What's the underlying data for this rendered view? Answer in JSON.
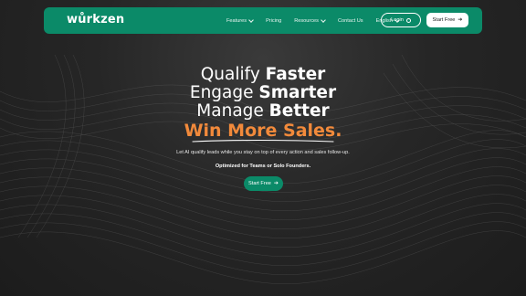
{
  "brand": {
    "logo_text": "wůrkzen",
    "primary_color": "#0b8a68",
    "accent_color": "#f28a3b"
  },
  "nav": {
    "items": [
      {
        "label": "Features",
        "has_dropdown": true
      },
      {
        "label": "Pricing",
        "has_dropdown": false
      },
      {
        "label": "Resources",
        "has_dropdown": true
      },
      {
        "label": "Contact Us",
        "has_dropdown": false
      },
      {
        "label": "English",
        "has_dropdown": true
      }
    ],
    "login_label": "Login",
    "login_icon": "user-circle-icon",
    "start_label": "Start Free",
    "start_icon": "arrow-right-icon"
  },
  "hero": {
    "line1": {
      "light": "Qualify ",
      "bold": "Faster"
    },
    "line2": {
      "light": "Engage ",
      "bold": "Smarter"
    },
    "line3": {
      "light": "Manage ",
      "bold": "Better"
    },
    "accent": "Win More Sales.",
    "subtitle": "Let AI qualify leads while you stay on top of every action and sales follow-up.",
    "tagline": "Optimized for Teams or Solo Founders.",
    "cta_label": "Start Free",
    "cta_icon": "arrow-right-icon"
  }
}
